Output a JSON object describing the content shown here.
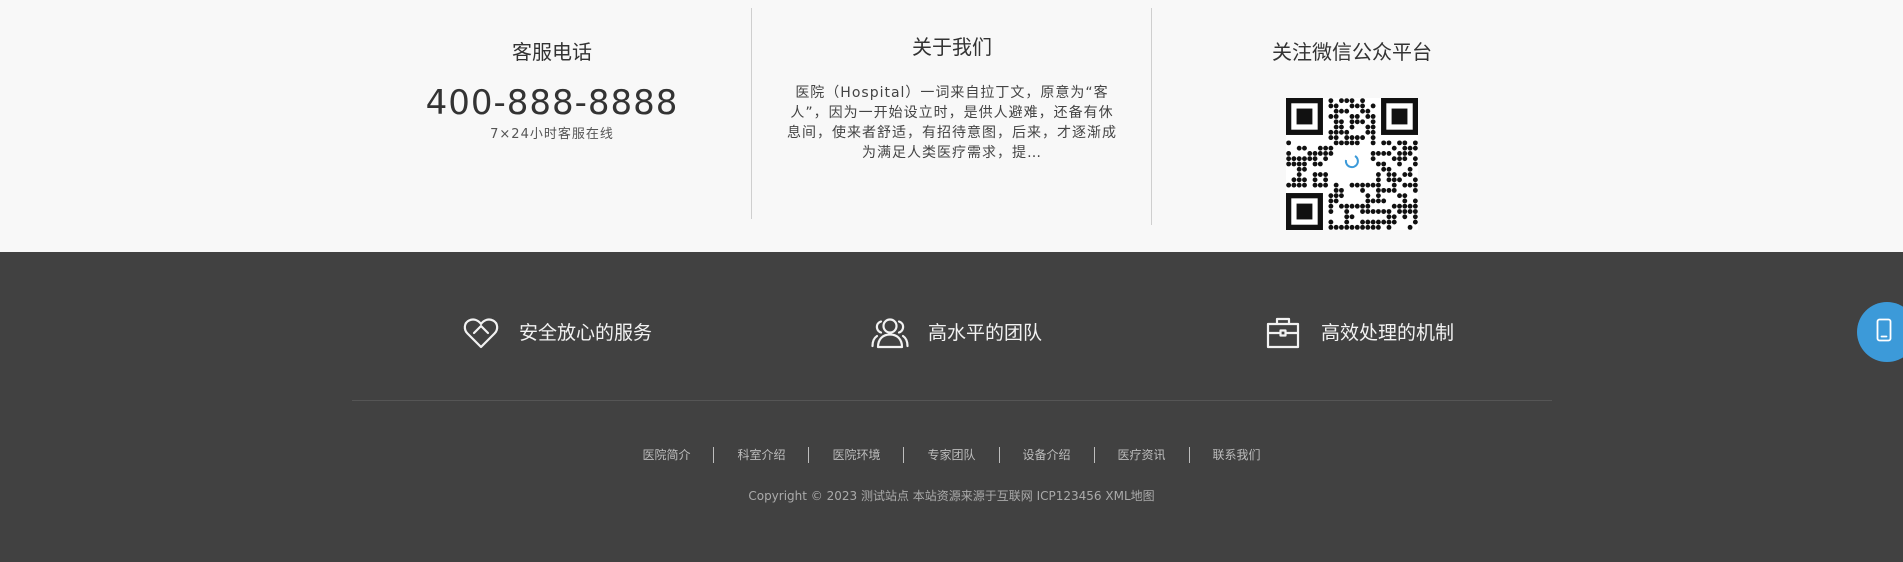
{
  "contact": {
    "title": "客服电话",
    "phone": "400-888-8888",
    "note": "7×24小时客服在线"
  },
  "about": {
    "title": "关于我们",
    "text": "医院（Hospital）一词来自拉丁文，原意为“客人”，因为一开始设立时，是供人避难，还备有休息间，使来者舒适，有招待意图，后来，才逐渐成为满足人类医疗需求，提…"
  },
  "wechat": {
    "title": "关注微信公众平台",
    "qr_icon": "qr-code-icon"
  },
  "features": [
    {
      "icon": "heart-icon",
      "label": "安全放心的服务"
    },
    {
      "icon": "team-icon",
      "label": "高水平的团队"
    },
    {
      "icon": "briefcase-icon",
      "label": "高效处理的机制"
    }
  ],
  "footer_nav": [
    "医院简介",
    "科室介绍",
    "医院环境",
    "专家团队",
    "设备介绍",
    "医疗资讯",
    "联系我们"
  ],
  "copyright": "Copyright © 2023 测试站点 本站资源来源于互联网 ICP123456 XML地图",
  "float_button": {
    "icon": "mobile-phone-icon"
  },
  "colors": {
    "top_bg": "#f8f8f8",
    "footer_bg": "#414141",
    "accent": "#3c9ad9"
  }
}
